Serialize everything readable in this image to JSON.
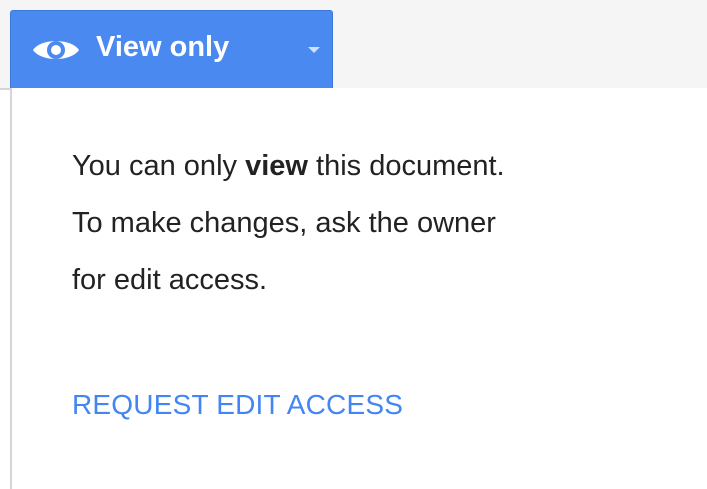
{
  "mode_menu": {
    "label": "View only",
    "icon": "eye-icon",
    "dropdown_icon": "caret-down-icon",
    "color": "#4a89f0"
  },
  "notice": {
    "line1_before": "You can only ",
    "line1_emphasis": "view",
    "line1_after": " this document.",
    "line2": "To make changes, ask the owner",
    "line3": "for edit access.",
    "text_color": "#222222"
  },
  "request_link": {
    "label": "REQUEST EDIT ACCESS",
    "color": "#4285f4"
  }
}
